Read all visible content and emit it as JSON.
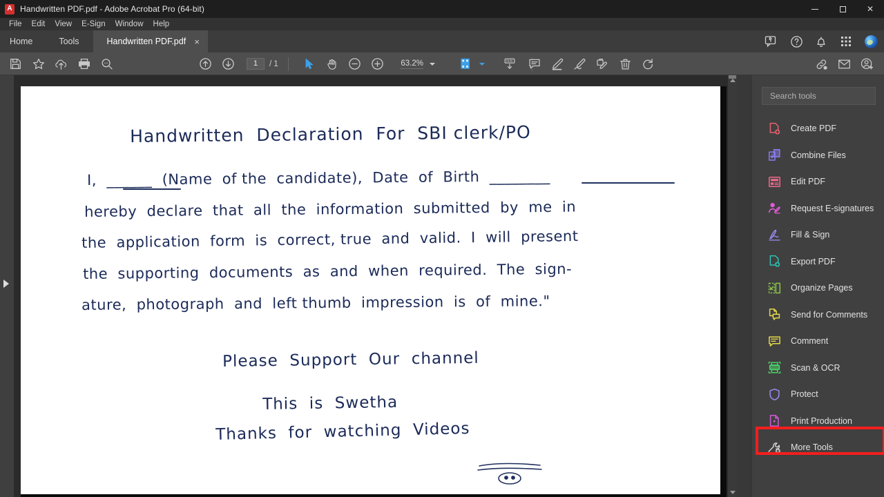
{
  "window": {
    "title": "Handwritten PDF.pdf - Adobe Acrobat Pro (64-bit)",
    "app_icon": "adobe-acrobat-icon",
    "controls": {
      "minimize": "minimize-icon",
      "maximize": "maximize-icon",
      "close": "close-icon"
    }
  },
  "menubar": {
    "items": [
      {
        "label": "File"
      },
      {
        "label": "Edit"
      },
      {
        "label": "View"
      },
      {
        "label": "E-Sign"
      },
      {
        "label": "Window"
      },
      {
        "label": "Help"
      }
    ]
  },
  "tabbar": {
    "tabs": [
      {
        "label": "Home",
        "active": false
      },
      {
        "label": "Tools",
        "active": false
      },
      {
        "label": "Handwritten PDF.pdf",
        "active": true,
        "close": "×"
      }
    ],
    "right_icons": [
      {
        "name": "share-feedback-icon"
      },
      {
        "name": "help-icon"
      },
      {
        "name": "notification-bell-icon"
      },
      {
        "name": "app-grid-icon"
      },
      {
        "name": "user-avatar"
      }
    ]
  },
  "toolbar": {
    "left_tools": [
      {
        "name": "save-icon"
      },
      {
        "name": "star-favorite-icon"
      },
      {
        "name": "upload-cloud-icon"
      },
      {
        "name": "print-icon"
      },
      {
        "name": "zoom-search-icon"
      }
    ],
    "nav": {
      "prev_page": "arrow-up-circle-icon",
      "next_page": "arrow-down-circle-icon"
    },
    "page_number": "1",
    "page_total": "/ 1",
    "center_tools": [
      {
        "name": "select-cursor-icon"
      },
      {
        "name": "hand-pan-icon"
      },
      {
        "name": "zoom-out-icon"
      },
      {
        "name": "zoom-in-icon"
      }
    ],
    "zoom_level": "63.2%",
    "zoom_caret": "chevron-down-icon",
    "view_tools": [
      {
        "name": "page-fit-icon"
      },
      {
        "name": "page-fit-caret-icon"
      },
      {
        "name": "scroll-mode-icon"
      }
    ],
    "annotate_tools": [
      {
        "name": "add-comment-icon"
      },
      {
        "name": "highlight-icon"
      },
      {
        "name": "draw-freehand-icon"
      },
      {
        "name": "stamp-icon"
      },
      {
        "name": "delete-trash-icon"
      },
      {
        "name": "rotate-icon"
      }
    ],
    "share_tools": [
      {
        "name": "share-link-icon"
      },
      {
        "name": "email-icon"
      },
      {
        "name": "add-person-icon"
      }
    ]
  },
  "document": {
    "zoom_percent": "63.2%",
    "page_current": 1,
    "page_count": 1,
    "handwriting": {
      "title": "Handwritten  Declaration  For  SBI clerk/PO",
      "lines": [
        "I,  ______  (Name  of the  candidate),  Date  of  Birth  ________",
        "hereby  declare  that  all  the  information  submitted  by  me  in",
        "the  application  form  is  correct, true  and  valid.  I  will  present",
        "the  supporting  documents  as  and  when  required.  The  sign-",
        "ature,  photograph  and  left thumb  impression  is  of  mine.\""
      ],
      "closing": [
        "Please  Support  Our  channel",
        "This  is  Swetha",
        "Thanks  for  watching  Videos"
      ],
      "signature_doodle": "smiley-face-doodle",
      "ink_color": "#1b2a58"
    },
    "scrollbar": {
      "name": "vertical-scrollbar"
    },
    "left_panel_toggle": "expand-left-panel-arrow",
    "right_panel_toggle": "expand-right-panel-arrow"
  },
  "tools_panel": {
    "search": {
      "placeholder": "Search tools",
      "value": ""
    },
    "items": [
      {
        "label": "Create PDF",
        "icon": "create-pdf-icon",
        "color": "#e8616f"
      },
      {
        "label": "Combine Files",
        "icon": "combine-files-icon",
        "color": "#8a7cf0"
      },
      {
        "label": "Edit PDF",
        "icon": "edit-pdf-icon",
        "color": "#ef6a8c"
      },
      {
        "label": "Request E-signatures",
        "icon": "request-esignatures-icon",
        "color": "#e05ad6"
      },
      {
        "label": "Fill & Sign",
        "icon": "fill-and-sign-icon",
        "color": "#9b8cf5"
      },
      {
        "label": "Export PDF",
        "icon": "export-pdf-icon",
        "color": "#2fc2b3"
      },
      {
        "label": "Organize Pages",
        "icon": "organize-pages-icon",
        "color": "#8bc34a"
      },
      {
        "label": "Send for Comments",
        "icon": "send-for-comments-icon",
        "color": "#e4d84a"
      },
      {
        "label": "Comment",
        "icon": "comment-icon",
        "color": "#e4d84a"
      },
      {
        "label": "Scan & OCR",
        "icon": "scan-and-ocr-icon",
        "color": "#4bd46a",
        "highlighted": true
      },
      {
        "label": "Protect",
        "icon": "protect-shield-icon",
        "color": "#9b8cf5"
      },
      {
        "label": "Print Production",
        "icon": "print-production-icon",
        "color": "#d05ad6"
      },
      {
        "label": "More Tools",
        "icon": "more-tools-wrench-icon",
        "color": "#d8d8d8"
      }
    ],
    "highlight_color": "#f41e1e"
  }
}
